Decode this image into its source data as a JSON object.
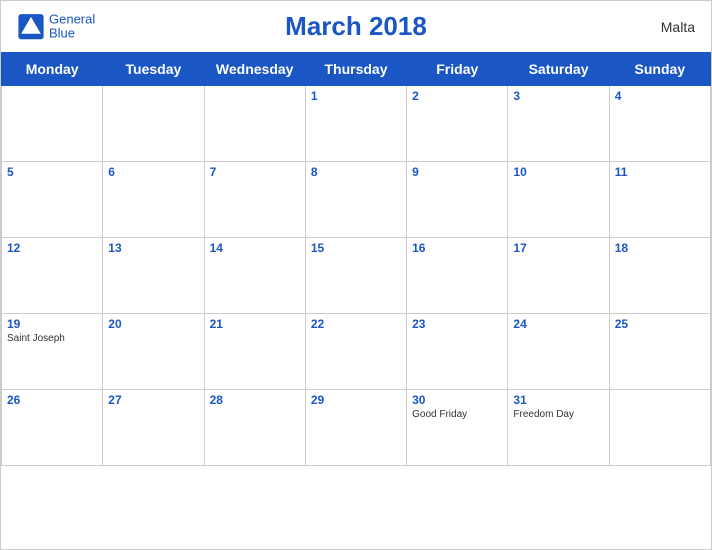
{
  "header": {
    "title": "March 2018",
    "country": "Malta",
    "logo_general": "General",
    "logo_blue": "Blue"
  },
  "weekdays": [
    "Monday",
    "Tuesday",
    "Wednesday",
    "Thursday",
    "Friday",
    "Saturday",
    "Sunday"
  ],
  "weeks": [
    [
      {
        "day": null,
        "events": []
      },
      {
        "day": null,
        "events": []
      },
      {
        "day": null,
        "events": []
      },
      {
        "day": 1,
        "events": []
      },
      {
        "day": 2,
        "events": []
      },
      {
        "day": 3,
        "events": []
      },
      {
        "day": 4,
        "events": []
      }
    ],
    [
      {
        "day": 5,
        "events": []
      },
      {
        "day": 6,
        "events": []
      },
      {
        "day": 7,
        "events": []
      },
      {
        "day": 8,
        "events": []
      },
      {
        "day": 9,
        "events": []
      },
      {
        "day": 10,
        "events": []
      },
      {
        "day": 11,
        "events": []
      }
    ],
    [
      {
        "day": 12,
        "events": []
      },
      {
        "day": 13,
        "events": []
      },
      {
        "day": 14,
        "events": []
      },
      {
        "day": 15,
        "events": []
      },
      {
        "day": 16,
        "events": []
      },
      {
        "day": 17,
        "events": []
      },
      {
        "day": 18,
        "events": []
      }
    ],
    [
      {
        "day": 19,
        "events": [
          "Saint Joseph"
        ]
      },
      {
        "day": 20,
        "events": []
      },
      {
        "day": 21,
        "events": []
      },
      {
        "day": 22,
        "events": []
      },
      {
        "day": 23,
        "events": []
      },
      {
        "day": 24,
        "events": []
      },
      {
        "day": 25,
        "events": []
      }
    ],
    [
      {
        "day": 26,
        "events": []
      },
      {
        "day": 27,
        "events": []
      },
      {
        "day": 28,
        "events": []
      },
      {
        "day": 29,
        "events": []
      },
      {
        "day": 30,
        "events": [
          "Good Friday"
        ]
      },
      {
        "day": 31,
        "events": [
          "Freedom Day"
        ]
      },
      {
        "day": null,
        "events": []
      }
    ]
  ]
}
